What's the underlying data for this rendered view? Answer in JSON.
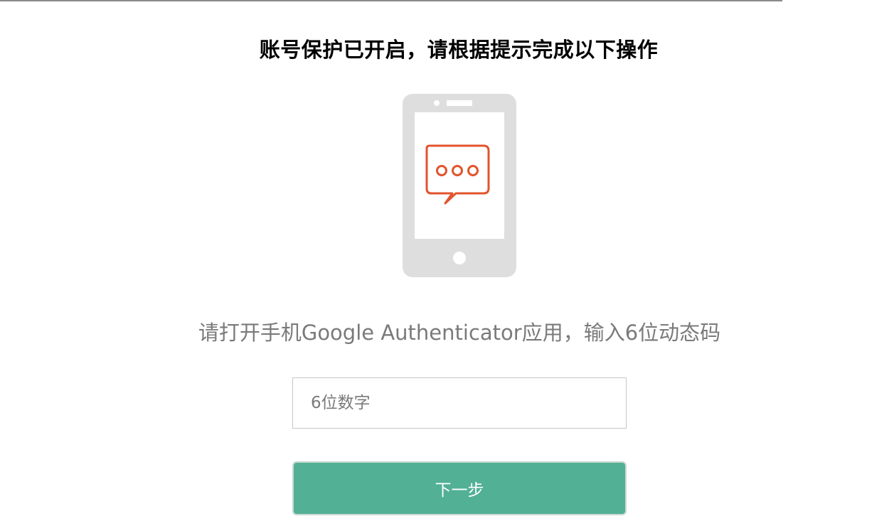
{
  "header": {
    "title": "账号保护已开启，请根据提示完成以下操作"
  },
  "illustration": {
    "icon": "phone-message-icon",
    "phone_color": "#dedede",
    "bubble_color": "#e2542c"
  },
  "instruction": {
    "text": "请打开手机Google Authenticator应用，输入6位动态码"
  },
  "form": {
    "code_placeholder": "6位数字",
    "code_value": "",
    "next_label": "下一步"
  },
  "colors": {
    "accent": "#52b095",
    "muted_text": "#7a7a7a"
  }
}
